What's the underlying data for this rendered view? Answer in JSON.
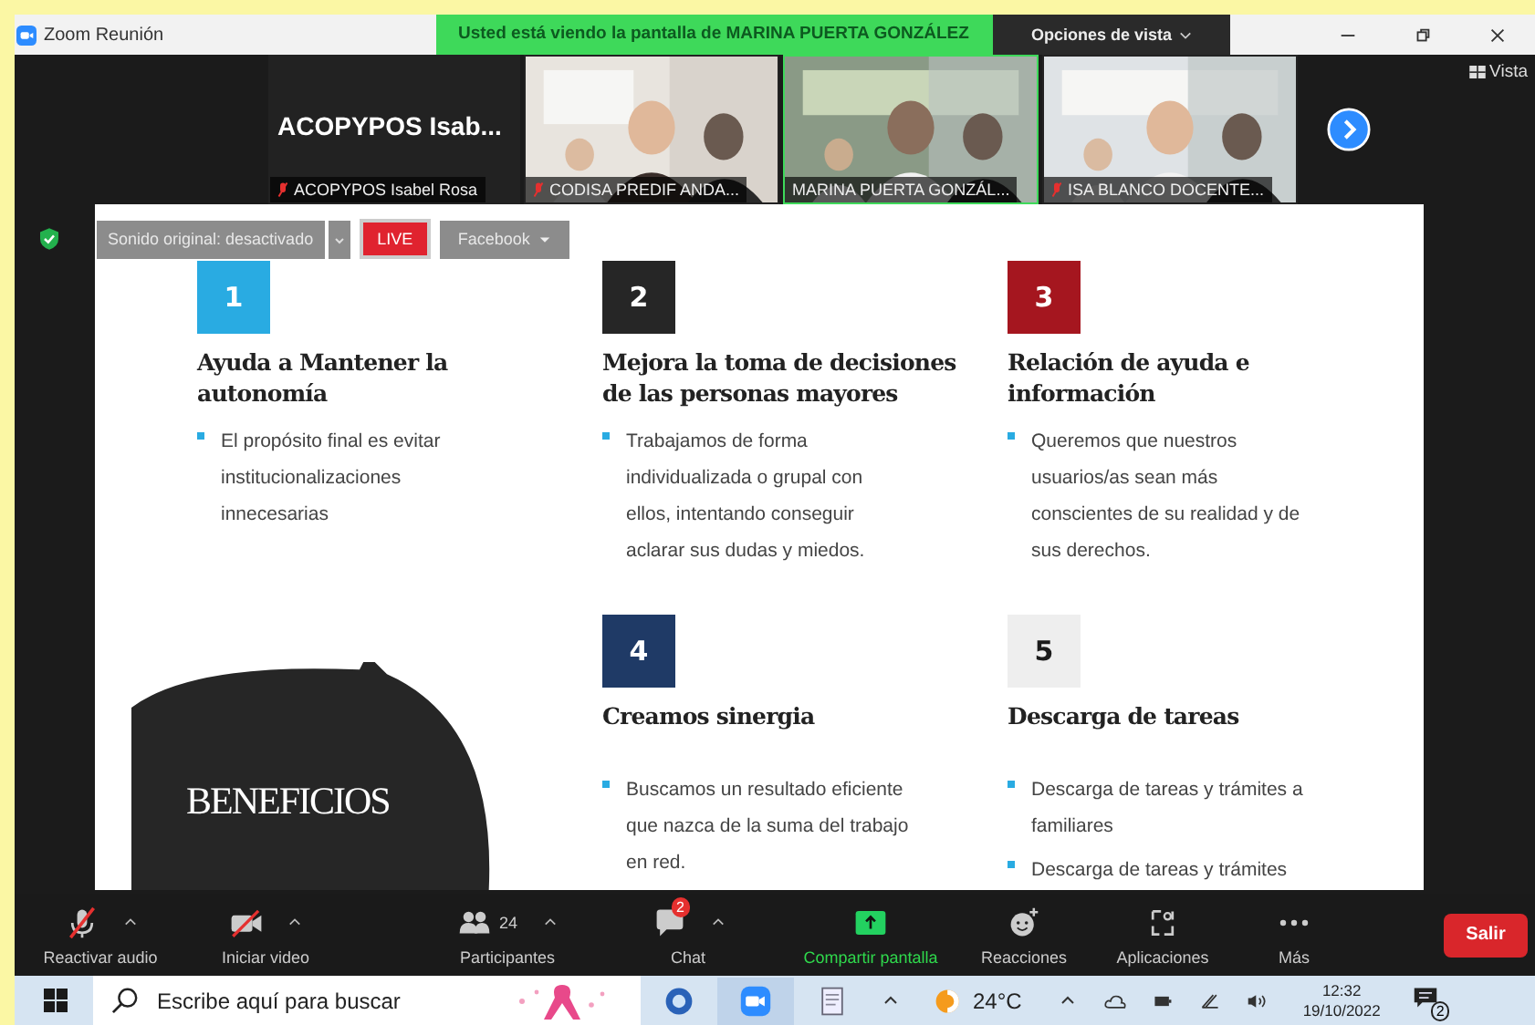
{
  "window": {
    "title": "Zoom Reunión"
  },
  "banner": {
    "text": "Usted está viendo la pantalla de MARINA PUERTA GONZÁLEZ",
    "view_options": "Opciones de vista"
  },
  "gallery": {
    "tiles": [
      {
        "kind": "name",
        "title": "ACOPYPOS  Isab...",
        "label": "ACOPYPOS Isabel Rosa",
        "muted": true,
        "speaking": false
      },
      {
        "kind": "video",
        "label": "CODISA PREDIF ANDA...",
        "muted": true,
        "speaking": false
      },
      {
        "kind": "video",
        "label": "MARINA PUERTA GONZÁL...",
        "muted": false,
        "speaking": true
      },
      {
        "kind": "video",
        "label": "ISA BLANCO DOCENTE...",
        "muted": true,
        "speaking": false
      }
    ],
    "view": "Vista"
  },
  "share_bar": {
    "audio": "Sonido original: desactivado",
    "live": "LIVE",
    "stream": "Facebook"
  },
  "slide": {
    "title": "BENEFICIOS",
    "items": [
      {
        "number": "1",
        "color": "#29abe2",
        "title": "Ayuda a Mantener la autonomía",
        "bullets": [
          "El propósito final es evitar institucionalizaciones innecesarias"
        ]
      },
      {
        "number": "2",
        "color": "#262626",
        "title": "Mejora la toma de decisiones de las personas mayores",
        "bullets": [
          "Trabajamos de forma individualizada o grupal con ellos, intentando conseguir aclarar sus dudas y miedos."
        ]
      },
      {
        "number": "3",
        "color": "#a5161f",
        "title": "Relación de ayuda e información",
        "bullets": [
          "Queremos que nuestros usuarios/as sean más conscientes de su realidad y de sus derechos."
        ]
      },
      {
        "number": "4",
        "color": "#1f3a66",
        "title": "Creamos sinergia",
        "bullets": [
          "Buscamos un resultado eficiente que nazca de la suma del trabajo en red."
        ]
      },
      {
        "number": "5",
        "color": "#eeeeee",
        "title": "Descarga de tareas",
        "bullets": [
          "Descarga de tareas y trámites a familiares",
          "Descarga de tareas y trámites"
        ]
      }
    ]
  },
  "toolbar": {
    "items": [
      {
        "kind": "audio",
        "label": "Reactivar audio",
        "caret": true
      },
      {
        "kind": "video",
        "label": "Iniciar video",
        "caret": true
      },
      {
        "kind": "participants",
        "label": "Participantes",
        "count": "24",
        "caret": true
      },
      {
        "kind": "chat",
        "label": "Chat",
        "badge": "2",
        "caret": true
      },
      {
        "kind": "share",
        "label": "Compartir pantalla",
        "caret": false
      },
      {
        "kind": "reactions",
        "label": "Reacciones",
        "caret": false
      },
      {
        "kind": "apps",
        "label": "Aplicaciones",
        "caret": false
      },
      {
        "kind": "more",
        "label": "Más",
        "caret": false
      }
    ],
    "leave": "Salir"
  },
  "taskbar": {
    "search": {
      "placeholder": "Escribe aquí para buscar"
    },
    "temperature": "24°C",
    "time": "12:32",
    "date": "19/10/2022",
    "notifications": "2"
  }
}
